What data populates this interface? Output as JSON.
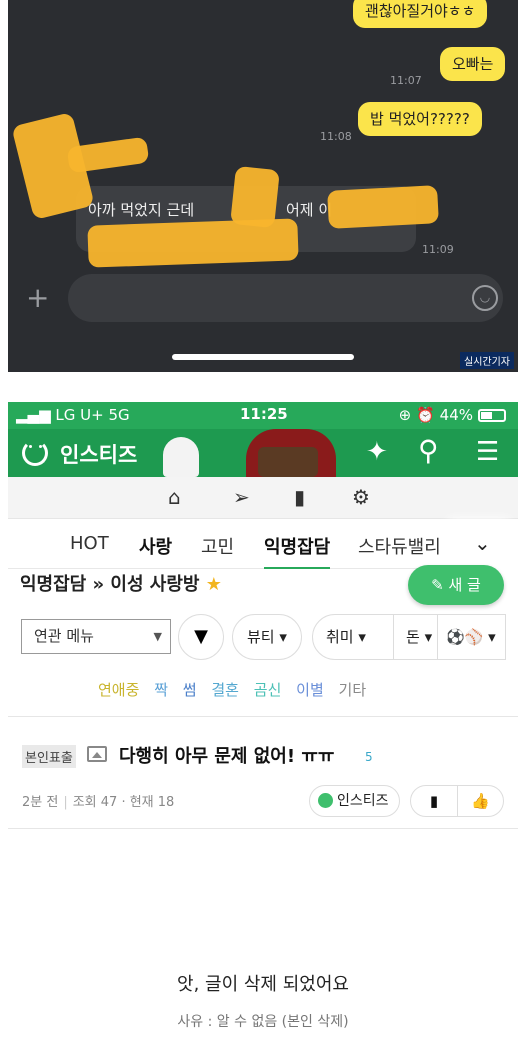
{
  "chat": {
    "messages": [
      {
        "text": "괜찮아질거야ㅎㅎ",
        "time": ""
      },
      {
        "text": "오빠는",
        "time": "11:07"
      },
      {
        "text": "밥 먹었어?????",
        "time": "11:08"
      },
      {
        "text_a": "아까 먹었지 근데",
        "text_b": "어제 이",
        "time": "11:09"
      }
    ],
    "watermark": "실시간기자"
  },
  "status_bar": {
    "carrier": "LG U+ 5G",
    "time": "11:25",
    "battery": "44%"
  },
  "app": {
    "name": "인스티즈"
  },
  "tabs": [
    "HOT",
    "사랑",
    "고민",
    "익명잡담",
    "스타듀밸리"
  ],
  "board": {
    "title": "익명잡담 » 이성 사랑방",
    "new_post_label": "새 글"
  },
  "filters": {
    "select_value": "연관 메뉴",
    "pills": [
      "뷰티 ▾",
      "취미 ▾",
      "돈 ▾"
    ]
  },
  "categories": [
    "연애중",
    "짝",
    "썸",
    "결혼",
    "곰신",
    "이별",
    "기타"
  ],
  "category_colors": [
    "#c9b52f",
    "#5aa0d6",
    "#4a7fc9",
    "#55a8d0",
    "#4cc0b6",
    "#6a8fd8",
    "#8a8a8a"
  ],
  "post": {
    "badge": "본인표출",
    "title": "다행히 아무 문제 없어! ㅠㅠ",
    "comment_count": "5",
    "time_ago": "2분 전",
    "views": "조회 47 · 현재 18",
    "author": "인스티즈"
  },
  "notice": {
    "message": "앗, 글이 삭제 되었어요",
    "reason": "사유 : 알 수 없음 (본인 삭제)"
  }
}
